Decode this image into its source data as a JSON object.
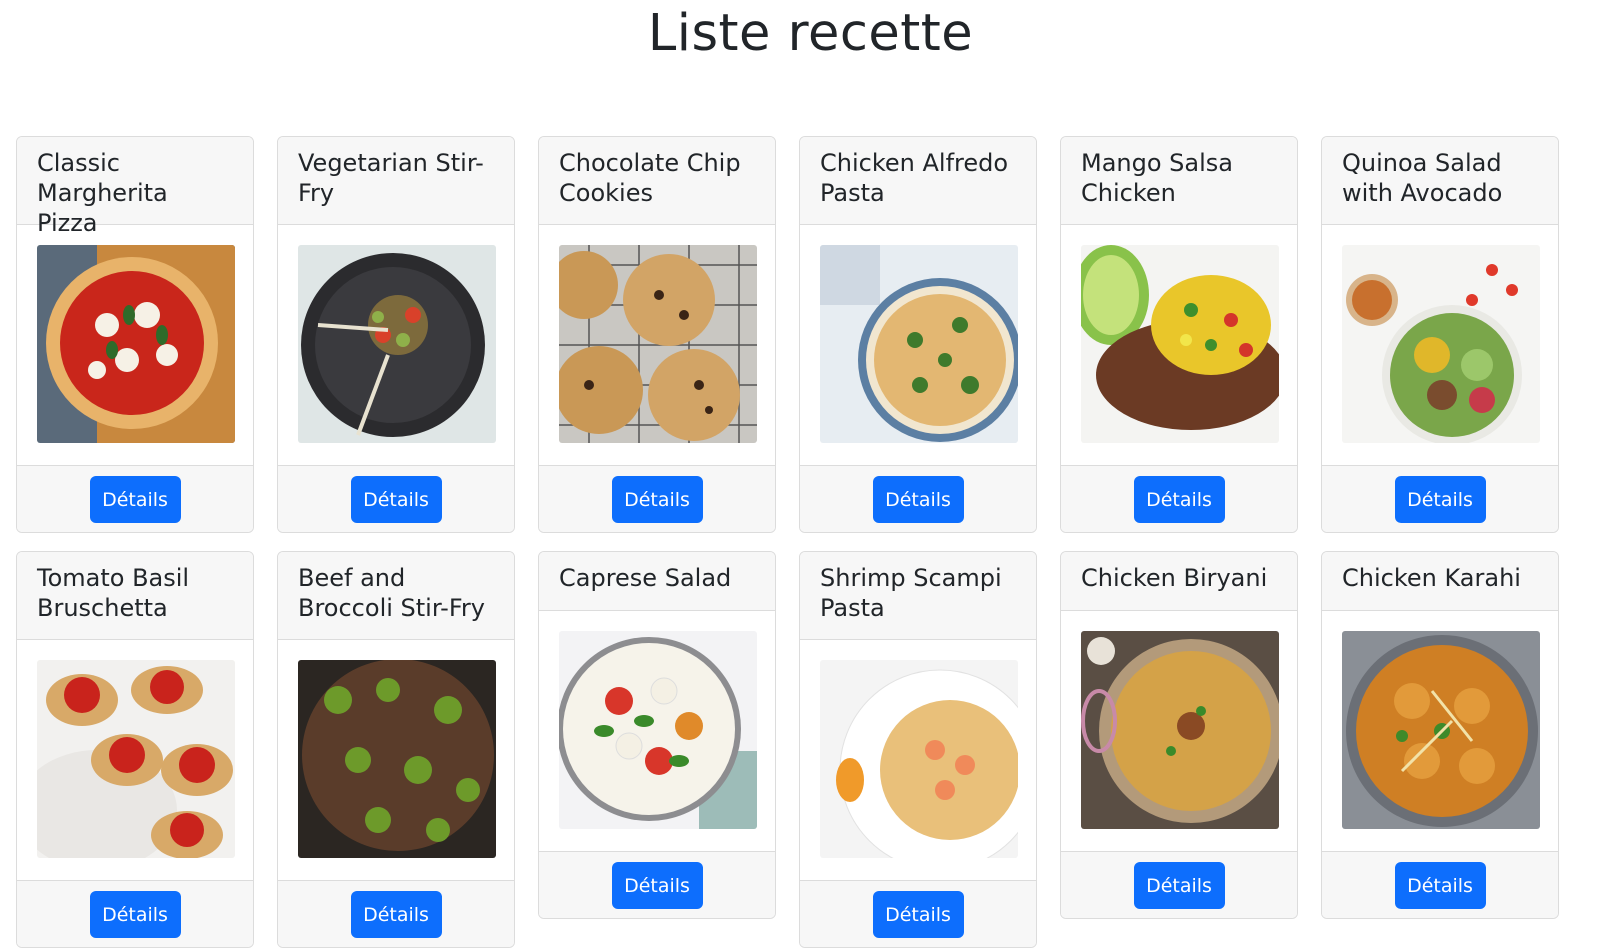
{
  "page": {
    "title": "Liste recette"
  },
  "button_label": "Détails",
  "recipes": [
    {
      "name": "Classic Margherita Pizza",
      "image": "pizza"
    },
    {
      "name": "Vegetarian Stir-Fry",
      "image": "stirfry"
    },
    {
      "name": "Chocolate Chip Cookies",
      "image": "cookies"
    },
    {
      "name": "Chicken Alfredo Pasta",
      "image": "alfredo"
    },
    {
      "name": "Mango Salsa Chicken",
      "image": "mango"
    },
    {
      "name": "Quinoa Salad with Avocado",
      "image": "quinoa"
    },
    {
      "name": "Tomato Basil Bruschetta",
      "image": "bruschetta"
    },
    {
      "name": "Beef and Broccoli Stir-Fry",
      "image": "beef"
    },
    {
      "name": "Caprese Salad",
      "image": "caprese"
    },
    {
      "name": "Shrimp Scampi Pasta",
      "image": "shrimp"
    },
    {
      "name": "Chicken Biryani",
      "image": "biryani"
    },
    {
      "name": "Chicken Karahi",
      "image": "karahi"
    }
  ],
  "colors": {
    "primary": "#0d6efd",
    "card_header_bg": "#f7f7f7",
    "border": "#dcdcdc"
  }
}
